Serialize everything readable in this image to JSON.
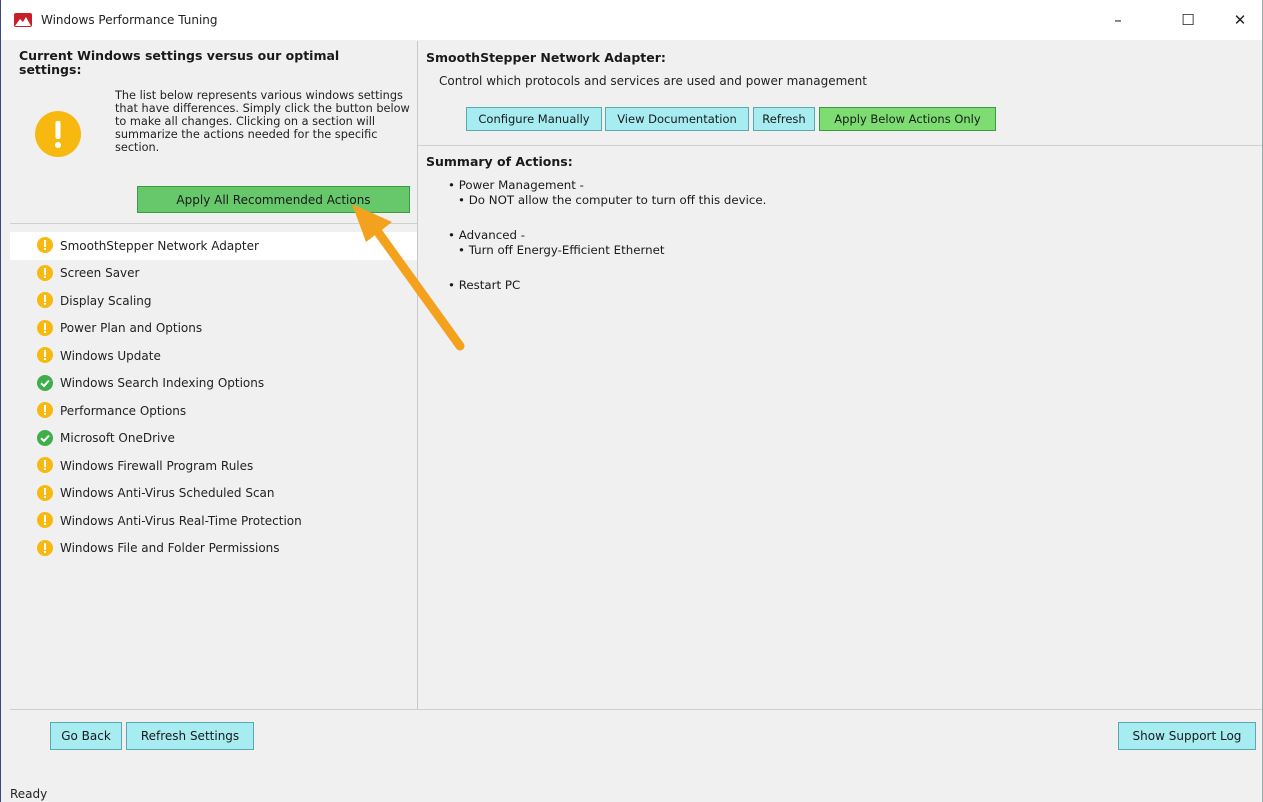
{
  "window": {
    "title": "Windows Performance Tuning",
    "controls": {
      "minimize": "–",
      "maximize": "☐",
      "close": "✕"
    }
  },
  "left": {
    "heading": "Current Windows settings versus our optimal settings:",
    "description": "The list below represents various windows settings that have differences. Simply click the button below to make all changes. Clicking on a section will summarize the actions needed for the specific section.",
    "apply_all_label": "Apply All Recommended Actions",
    "sections": [
      {
        "label": "SmoothStepper Network Adapter",
        "status": "warning"
      },
      {
        "label": "Screen Saver",
        "status": "warning"
      },
      {
        "label": "Display Scaling",
        "status": "warning"
      },
      {
        "label": "Power Plan and Options",
        "status": "warning"
      },
      {
        "label": "Windows Update",
        "status": "warning"
      },
      {
        "label": "Windows Search Indexing Options",
        "status": "ok"
      },
      {
        "label": "Performance Options",
        "status": "warning"
      },
      {
        "label": "Microsoft OneDrive",
        "status": "ok"
      },
      {
        "label": "Windows Firewall Program Rules",
        "status": "warning"
      },
      {
        "label": "Windows Anti-Virus Scheduled Scan",
        "status": "warning"
      },
      {
        "label": "Windows Anti-Virus Real-Time Protection",
        "status": "warning"
      },
      {
        "label": "Windows File and Folder Permissions",
        "status": "warning"
      }
    ]
  },
  "right": {
    "title": "SmoothStepper Network Adapter:",
    "subtitle": "Control which protocols and services are used and power management",
    "buttons": {
      "configure": "Configure Manually",
      "documentation": "View Documentation",
      "refresh": "Refresh",
      "apply_below": "Apply Below Actions Only"
    },
    "summary_title": "Summary of Actions:",
    "summary": {
      "power_management": "• Power Management -",
      "power_management_item": "• Do NOT allow the computer to turn off this device.",
      "advanced": "• Advanced -",
      "advanced_item": "• Turn off Energy-Efficient Ethernet",
      "restart": "• Restart PC"
    }
  },
  "bottom": {
    "go_back": "Go Back",
    "refresh_settings": "Refresh Settings",
    "show_support_log": "Show Support Log",
    "status": "Ready"
  },
  "colors": {
    "warning": "#f7b90f",
    "ok": "#3fae4a",
    "apply_green": "#66c86a",
    "cyan_button": "#a6ecf0",
    "arrow": "#f4a21e"
  }
}
